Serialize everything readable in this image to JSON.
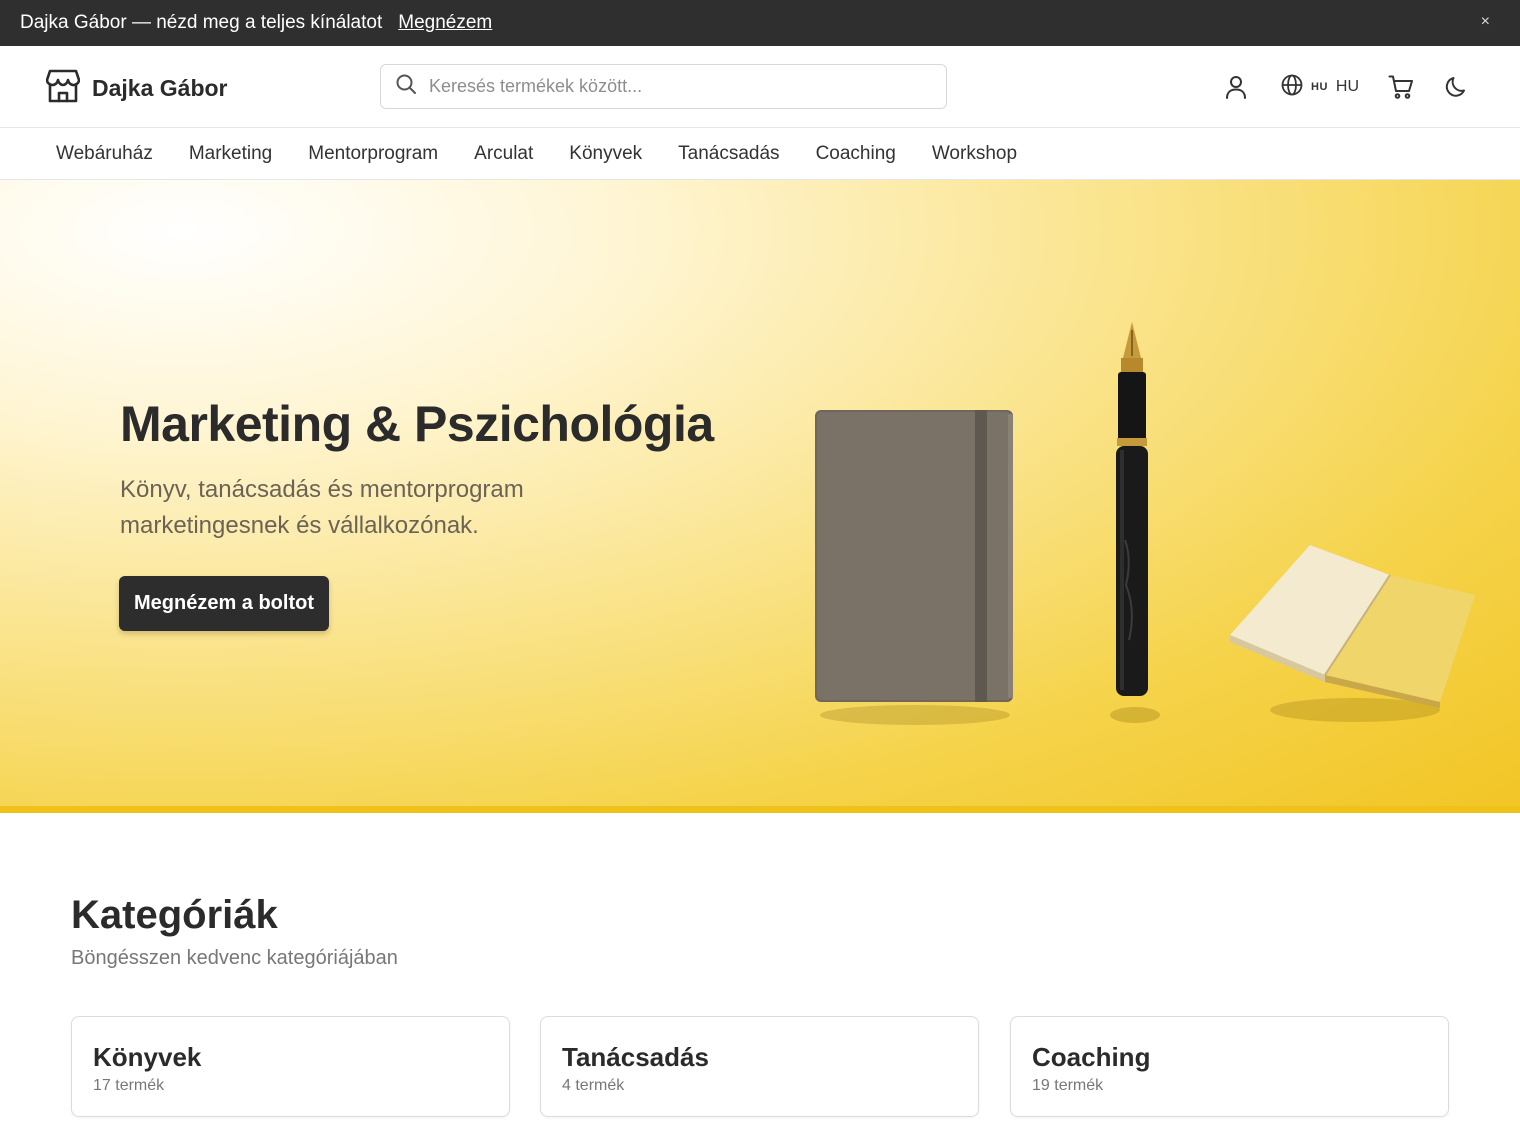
{
  "announcement": {
    "text": "Dajka Gábor — nézd meg a teljes kínálatot",
    "link": "Megnézem",
    "close": "×"
  },
  "header": {
    "brand": "Dajka Gábor",
    "search_placeholder": "Keresés termékek között...",
    "language": {
      "code_small": "HU",
      "code": "HU"
    },
    "icons": [
      "store-icon",
      "search-icon",
      "user-icon",
      "globe-icon",
      "cart-icon",
      "moon-icon"
    ]
  },
  "nav": {
    "items": [
      "Webáruház",
      "Marketing",
      "Mentorprogram",
      "Arculat",
      "Könyvek",
      "Tanácsadás",
      "Coaching",
      "Workshop"
    ]
  },
  "hero": {
    "title": "Marketing & Pszichológia",
    "subtitle": "Könyv, tanácsadás és mentorprogram marketingesnek és vállalkozónak.",
    "cta": "Megnézem a boltot"
  },
  "categories": {
    "title": "Kategóriák",
    "subtitle": "Böngésszen kedvenc kategóriájában",
    "items": [
      {
        "name": "Könyvek",
        "count": "17 termék"
      },
      {
        "name": "Tanácsadás",
        "count": "4 termék"
      },
      {
        "name": "Coaching",
        "count": "19 termék"
      }
    ]
  },
  "colors": {
    "dark": "#2d2d2d",
    "accent_yellow": "#f2c525",
    "muted_text": "#777777"
  }
}
